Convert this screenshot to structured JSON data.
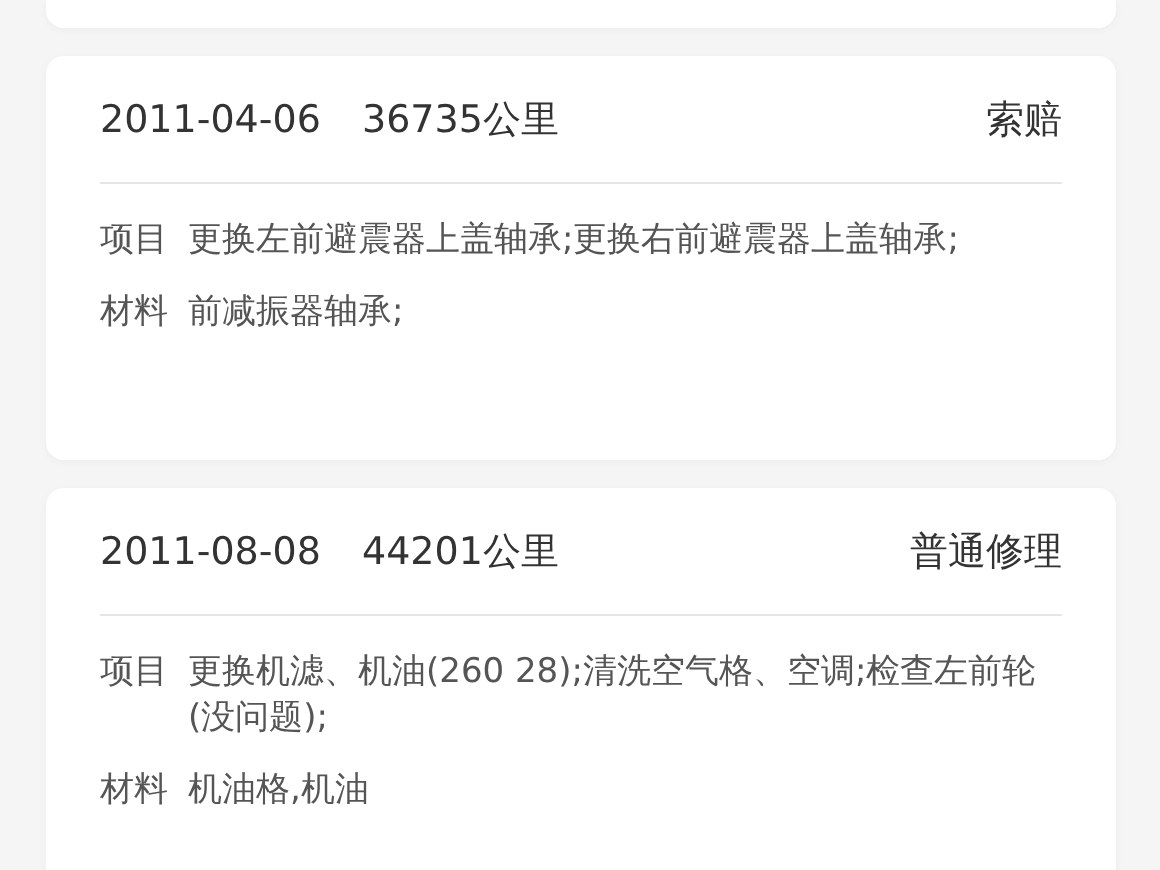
{
  "records": [
    {
      "date": "2011-04-06",
      "mileage": "36735公里",
      "type": "索赔",
      "rows": [
        {
          "label": "项目",
          "text": "更换左前避震器上盖轴承;更换右前避震器上盖轴承;"
        },
        {
          "label": "材料",
          "text": "前减振器轴承;"
        }
      ]
    },
    {
      "date": "2011-08-08",
      "mileage": "44201公里",
      "type": "普通修理",
      "rows": [
        {
          "label": "项目",
          "text": "更换机滤、机油(260 28);清洗空气格、空调;检查左前轮(没问题);"
        },
        {
          "label": "材料",
          "text": "机油格,机油"
        }
      ]
    }
  ]
}
